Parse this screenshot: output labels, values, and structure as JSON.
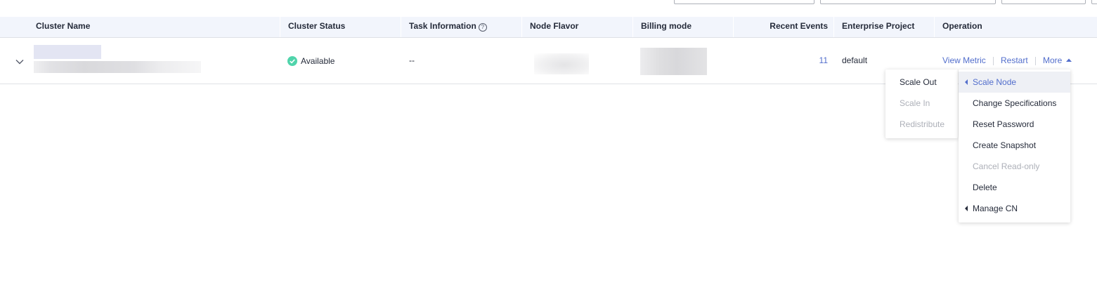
{
  "table": {
    "headers": {
      "cluster_name": "Cluster Name",
      "cluster_status": "Cluster Status",
      "task_information": "Task Information",
      "node_flavor": "Node Flavor",
      "billing_mode": "Billing mode",
      "recent_events": "Recent Events",
      "enterprise_project": "Enterprise Project",
      "operation": "Operation"
    },
    "help_glyph": "?",
    "row": {
      "status": "Available",
      "task_information": "--",
      "recent_events": "11",
      "enterprise_project": "default",
      "operations": {
        "view_metric": "View Metric",
        "restart": "Restart",
        "more": "More"
      }
    }
  },
  "more_menu": {
    "items": [
      {
        "label": "Scale Node",
        "has_submenu": true,
        "active": true,
        "disabled": false
      },
      {
        "label": "Change Specifications",
        "has_submenu": false,
        "active": false,
        "disabled": false
      },
      {
        "label": "Reset Password",
        "has_submenu": false,
        "active": false,
        "disabled": false
      },
      {
        "label": "Create Snapshot",
        "has_submenu": false,
        "active": false,
        "disabled": false
      },
      {
        "label": "Cancel Read-only",
        "has_submenu": false,
        "active": false,
        "disabled": true
      },
      {
        "label": "Delete",
        "has_submenu": false,
        "active": false,
        "disabled": false
      },
      {
        "label": "Manage CN",
        "has_submenu": true,
        "active": false,
        "disabled": false
      }
    ]
  },
  "scale_submenu": {
    "items": [
      {
        "label": "Scale Out",
        "disabled": false
      },
      {
        "label": "Scale In",
        "disabled": true
      },
      {
        "label": "Redistribute",
        "disabled": true
      }
    ]
  },
  "colors": {
    "link": "#526ecc",
    "status_ok": "#50d4ab",
    "header_bg": "#f2f5fc",
    "disabled_text": "#adb0b8"
  },
  "icons": {
    "expand": "chevron-down-icon",
    "status": "check-circle-icon",
    "more": "caret-up-icon",
    "submenu": "caret-left-icon",
    "help": "help-circle-icon"
  }
}
